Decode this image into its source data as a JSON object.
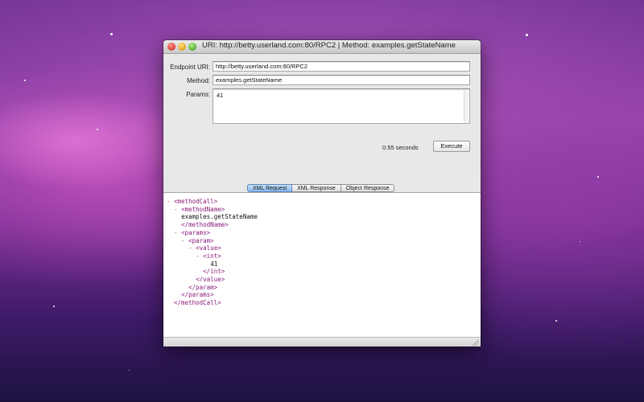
{
  "window": {
    "title": "URI: http://betty.userland.com:80/RPC2 | Method: examples.getStateName"
  },
  "form": {
    "endpoint_label": "Endpoint URI:",
    "endpoint_value": "http://betty.userland.com:80/RPC2",
    "method_label": "Method:",
    "method_value": "examples.getStateName",
    "params_label": "Params:",
    "params_value": "41",
    "timing": "0.55 seconds",
    "execute_label": "Execute"
  },
  "tabs": [
    {
      "label": "XML Request",
      "active": true
    },
    {
      "label": "XML Response",
      "active": false
    },
    {
      "label": "Object Response",
      "active": false
    }
  ],
  "xml_lines": [
    {
      "toggle": "- ",
      "tag": "<methodCall>",
      "text": ""
    },
    {
      "toggle": "  - ",
      "tag": "<methodName>",
      "text": ""
    },
    {
      "toggle": "    ",
      "tag": "",
      "text": "examples.getStateName"
    },
    {
      "toggle": "    ",
      "tag": "</methodName>",
      "text": ""
    },
    {
      "toggle": "  - ",
      "tag": "<params>",
      "text": ""
    },
    {
      "toggle": "    - ",
      "tag": "<param>",
      "text": ""
    },
    {
      "toggle": "      - ",
      "tag": "<value>",
      "text": ""
    },
    {
      "toggle": "        - ",
      "tag": "<int>",
      "text": ""
    },
    {
      "toggle": "            ",
      "tag": "",
      "text": "41"
    },
    {
      "toggle": "          ",
      "tag": "</int>",
      "text": ""
    },
    {
      "toggle": "        ",
      "tag": "</value>",
      "text": ""
    },
    {
      "toggle": "      ",
      "tag": "</param>",
      "text": ""
    },
    {
      "toggle": "    ",
      "tag": "</params>",
      "text": ""
    },
    {
      "toggle": "  ",
      "tag": "</methodCall>",
      "text": ""
    }
  ]
}
